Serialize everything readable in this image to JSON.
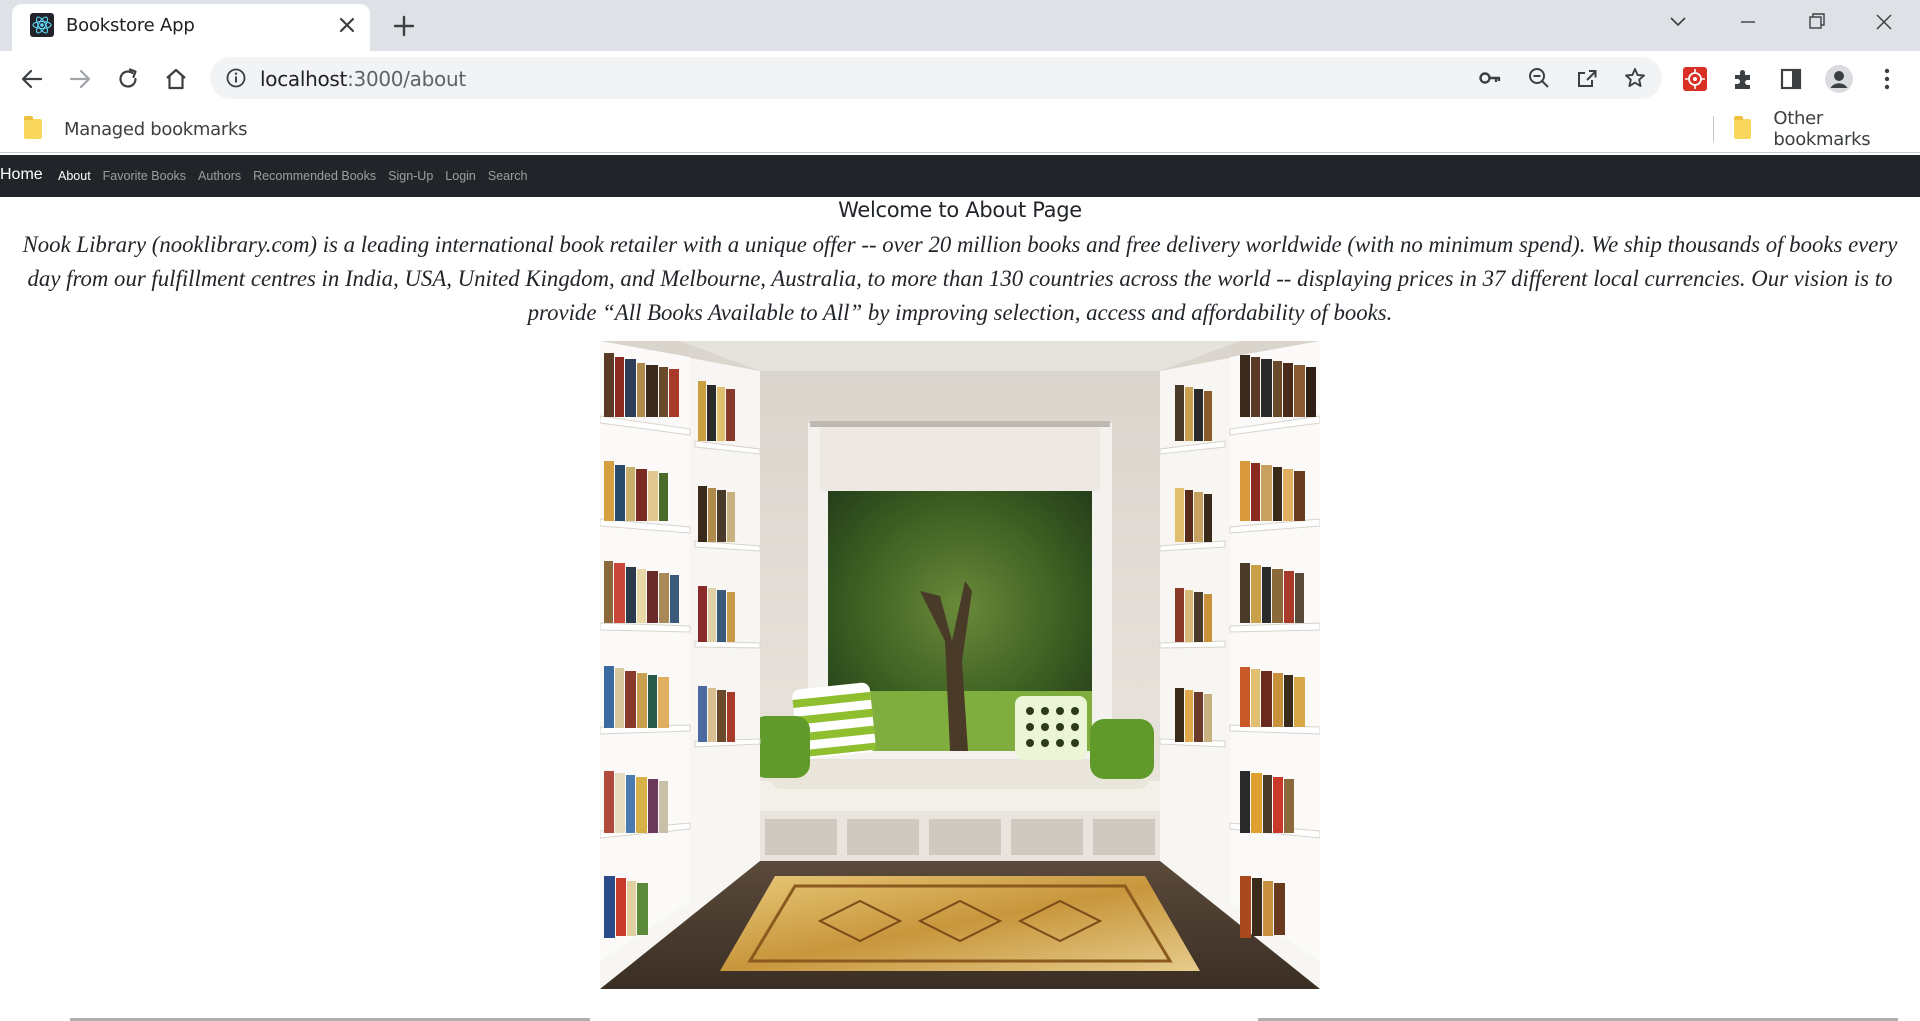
{
  "browser": {
    "tab_title": "Bookstore App",
    "url_host": "localhost",
    "url_path": ":3000/about",
    "bookmarks": [
      {
        "label": "Managed bookmarks"
      },
      {
        "label": "Other bookmarks"
      }
    ]
  },
  "navbar": {
    "brand": "Home",
    "links": [
      {
        "label": "About",
        "active": true
      },
      {
        "label": "Favorite Books"
      },
      {
        "label": "Authors"
      },
      {
        "label": "Recommended Books"
      },
      {
        "label": "Sign-Up"
      },
      {
        "label": "Login"
      },
      {
        "label": "Search"
      }
    ]
  },
  "main": {
    "heading": "Welcome to About Page",
    "paragraph": "Nook Library (nooklibrary.com) is a leading international book retailer with a unique offer -- over 20 million books and free delivery worldwide (with no minimum spend). We ship thousands of books every day from our fulfillment centres in India, USA, United Kingdom, and Melbourne, Australia, to more than 130 countries across the world -- displaying prices in 37 different local currencies. Our vision is to provide “All Books Available to All” by improving selection, access and affordability of books."
  },
  "colors": {
    "navbar_bg": "#212529",
    "tabstrip_bg": "#dee1e6",
    "omnibox_bg": "#f1f3f4"
  },
  "icons": {
    "tab_favicon": "react-logo-icon",
    "tab_close": "close-icon",
    "new_tab": "plus-icon",
    "back": "arrow-left-icon",
    "forward": "arrow-right-icon",
    "reload": "reload-icon",
    "home": "home-icon",
    "site_info": "info-icon",
    "passwords": "key-icon",
    "zoom": "zoom-out-icon",
    "share": "share-icon",
    "bookmark_star": "star-icon",
    "extension": "puzzle-icon",
    "side_panel": "side-panel-icon",
    "profile": "profile-icon",
    "menu": "kebab-menu-icon"
  }
}
